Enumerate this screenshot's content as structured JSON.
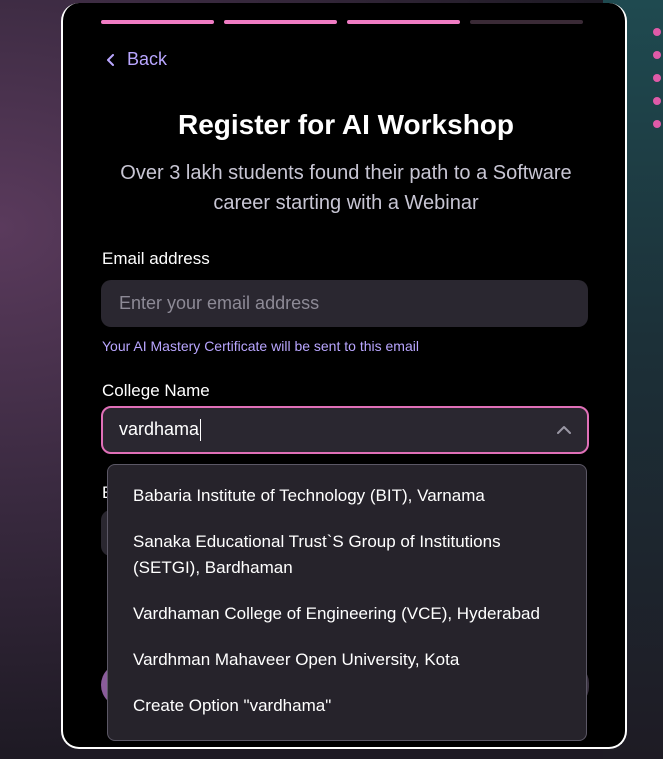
{
  "progress": {
    "total_steps": 4,
    "completed_steps": 3
  },
  "nav": {
    "back_label": "Back"
  },
  "header": {
    "title": "Register for AI Workshop",
    "subtitle": "Over 3 lakh students found their path to a Software career starting with a Webinar"
  },
  "form": {
    "email": {
      "label": "Email address",
      "placeholder": "Enter your email address",
      "value": "",
      "hint": "Your AI Mastery Certificate will be sent to this email"
    },
    "college": {
      "label": "College Name",
      "value": "vardhama",
      "options": [
        "Babaria Institute of Technology (BIT), Varnama",
        "Sanaka Educational Trust`S Group of Institutions (SETGI), Bardhaman",
        "Vardhaman College of Engineering (VCE), Hyderabad",
        "Vardhman Mahaveer Open University, Kota",
        "Create Option \"vardhama\""
      ]
    },
    "partially_hidden_label": "E"
  },
  "colors": {
    "accent": "#f07cc4",
    "link": "#b9a6ff",
    "focus_border": "#e070b8",
    "card_bg": "#000000",
    "input_bg": "#2a2730"
  }
}
